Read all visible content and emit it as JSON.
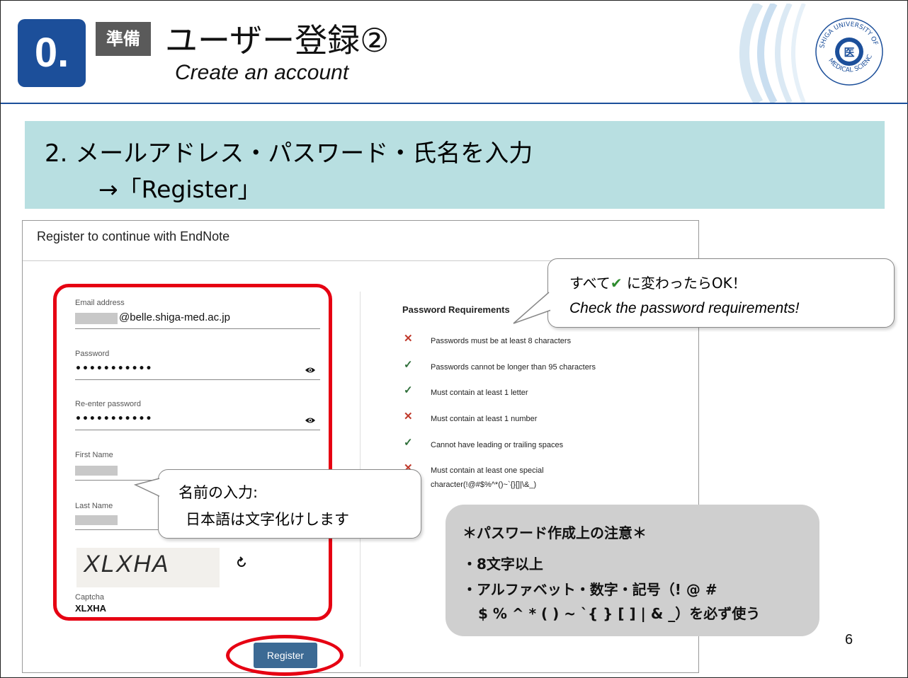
{
  "header": {
    "section_number": "0.",
    "prep_badge": "準備",
    "title_jp": "ユーザー登録②",
    "title_en": "Create an account"
  },
  "instruction": {
    "line1": "2.  メールアドレス・パスワード・氏名を入力",
    "line2": "→「Register」"
  },
  "form": {
    "title": "Register to continue with EndNote",
    "email_label": "Email address",
    "email_value": "@belle.shiga-med.ac.jp",
    "password_label": "Password",
    "password_value": "•••••••••••",
    "reenter_label": "Re-enter password",
    "reenter_value": "•••••••••••",
    "first_name_label": "First Name",
    "last_name_label": "Last Name",
    "captcha_image_text": "XLXHA",
    "captcha_label": "Captcha",
    "captcha_value": "XLXHA",
    "register_button": "Register"
  },
  "password_requirements": {
    "title": "Password Requirements",
    "items": [
      {
        "status": "fail",
        "mark": "✕",
        "text": "Passwords must be at least 8 characters"
      },
      {
        "status": "pass",
        "mark": "✓",
        "text": "Passwords cannot be longer than 95 characters"
      },
      {
        "status": "pass",
        "mark": "✓",
        "text": "Must contain at least 1 letter"
      },
      {
        "status": "fail",
        "mark": "✕",
        "text": "Must contain at least 1 number"
      },
      {
        "status": "pass",
        "mark": "✓",
        "text": "Cannot have leading or trailing spaces"
      },
      {
        "status": "fail",
        "mark": "✕",
        "text": "Must contain at least one special character(!@#$%^*()~`{}[]|\\&_)"
      }
    ]
  },
  "callouts": {
    "requirements_prefix": "すべて",
    "requirements_check": "✔",
    "requirements_suffix": " に変わったらOK！",
    "requirements_en": "Check the password requirements!",
    "name_line1": "名前の入力:",
    "name_line2": "日本語は文字化けします"
  },
  "password_note": {
    "title": "＊パスワード作成上の注意＊",
    "line1": "・8文字以上",
    "line2": "・アルファベット・数字・記号（! @ #",
    "line3": "$ % ^ * ( ) ~ `{ } [ ] | & _）を必ず使う"
  },
  "page_number": "6",
  "colors": {
    "section_blue": "#1c4f9a",
    "instruction_bg": "#b8dfe1",
    "annotation_red": "#e60012",
    "register_button": "#3c6a94",
    "fail_mark": "#c0392b",
    "pass_mark": "#2f6f3a"
  }
}
